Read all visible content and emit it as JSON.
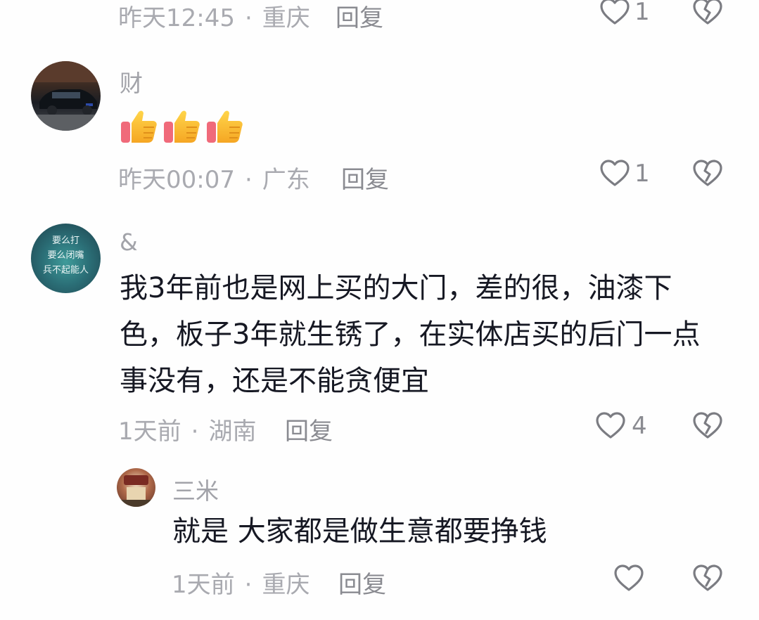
{
  "comments": [
    {
      "time": "昨天12:45",
      "location": "重庆",
      "reply_label": "回复",
      "likes": "1"
    },
    {
      "username": "财",
      "content_emojis": [
        "thumbs-up",
        "thumbs-up",
        "thumbs-up"
      ],
      "time": "昨天00:07",
      "location": "广东",
      "reply_label": "回复",
      "likes": "1",
      "avatar_text": ""
    },
    {
      "username": "&",
      "content_lines": [
        "我3年前也是网上买的大门，差的很，油漆下",
        "色，板子3年就生锈了，在实体店买的后门一点",
        "事没有，还是不能贪便宜"
      ],
      "time": "1天前",
      "location": "湖南",
      "reply_label": "回复",
      "likes": "4",
      "avatar_lines": [
        "要么打",
        "要么闭嘴",
        "兵不起能人"
      ],
      "replies": [
        {
          "username": "三米",
          "content": "就是 大家都是做生意都要挣钱",
          "time": "1天前",
          "location": "重庆",
          "reply_label": "回复",
          "likes": ""
        }
      ]
    }
  ],
  "colors": {
    "text": "#161823",
    "meta": "#a9aab0",
    "icon": "#7b7c82",
    "background": "#fefefe"
  },
  "separator": "·"
}
